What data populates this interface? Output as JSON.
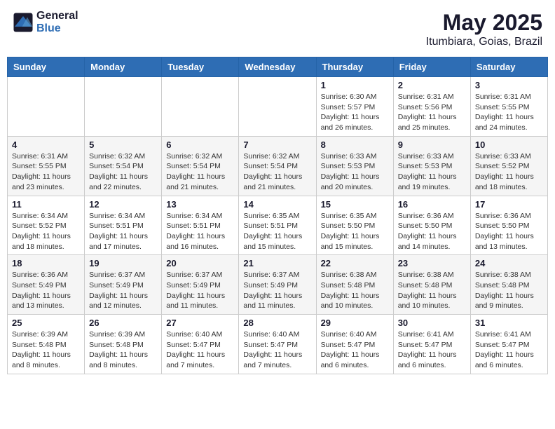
{
  "header": {
    "logo_general": "General",
    "logo_blue": "Blue",
    "month": "May 2025",
    "location": "Itumbiara, Goias, Brazil"
  },
  "days_of_week": [
    "Sunday",
    "Monday",
    "Tuesday",
    "Wednesday",
    "Thursday",
    "Friday",
    "Saturday"
  ],
  "weeks": [
    [
      {
        "day": "",
        "info": ""
      },
      {
        "day": "",
        "info": ""
      },
      {
        "day": "",
        "info": ""
      },
      {
        "day": "",
        "info": ""
      },
      {
        "day": "1",
        "info": "Sunrise: 6:30 AM\nSunset: 5:57 PM\nDaylight: 11 hours and 26 minutes."
      },
      {
        "day": "2",
        "info": "Sunrise: 6:31 AM\nSunset: 5:56 PM\nDaylight: 11 hours and 25 minutes."
      },
      {
        "day": "3",
        "info": "Sunrise: 6:31 AM\nSunset: 5:55 PM\nDaylight: 11 hours and 24 minutes."
      }
    ],
    [
      {
        "day": "4",
        "info": "Sunrise: 6:31 AM\nSunset: 5:55 PM\nDaylight: 11 hours and 23 minutes."
      },
      {
        "day": "5",
        "info": "Sunrise: 6:32 AM\nSunset: 5:54 PM\nDaylight: 11 hours and 22 minutes."
      },
      {
        "day": "6",
        "info": "Sunrise: 6:32 AM\nSunset: 5:54 PM\nDaylight: 11 hours and 21 minutes."
      },
      {
        "day": "7",
        "info": "Sunrise: 6:32 AM\nSunset: 5:54 PM\nDaylight: 11 hours and 21 minutes."
      },
      {
        "day": "8",
        "info": "Sunrise: 6:33 AM\nSunset: 5:53 PM\nDaylight: 11 hours and 20 minutes."
      },
      {
        "day": "9",
        "info": "Sunrise: 6:33 AM\nSunset: 5:53 PM\nDaylight: 11 hours and 19 minutes."
      },
      {
        "day": "10",
        "info": "Sunrise: 6:33 AM\nSunset: 5:52 PM\nDaylight: 11 hours and 18 minutes."
      }
    ],
    [
      {
        "day": "11",
        "info": "Sunrise: 6:34 AM\nSunset: 5:52 PM\nDaylight: 11 hours and 18 minutes."
      },
      {
        "day": "12",
        "info": "Sunrise: 6:34 AM\nSunset: 5:51 PM\nDaylight: 11 hours and 17 minutes."
      },
      {
        "day": "13",
        "info": "Sunrise: 6:34 AM\nSunset: 5:51 PM\nDaylight: 11 hours and 16 minutes."
      },
      {
        "day": "14",
        "info": "Sunrise: 6:35 AM\nSunset: 5:51 PM\nDaylight: 11 hours and 15 minutes."
      },
      {
        "day": "15",
        "info": "Sunrise: 6:35 AM\nSunset: 5:50 PM\nDaylight: 11 hours and 15 minutes."
      },
      {
        "day": "16",
        "info": "Sunrise: 6:36 AM\nSunset: 5:50 PM\nDaylight: 11 hours and 14 minutes."
      },
      {
        "day": "17",
        "info": "Sunrise: 6:36 AM\nSunset: 5:50 PM\nDaylight: 11 hours and 13 minutes."
      }
    ],
    [
      {
        "day": "18",
        "info": "Sunrise: 6:36 AM\nSunset: 5:49 PM\nDaylight: 11 hours and 13 minutes."
      },
      {
        "day": "19",
        "info": "Sunrise: 6:37 AM\nSunset: 5:49 PM\nDaylight: 11 hours and 12 minutes."
      },
      {
        "day": "20",
        "info": "Sunrise: 6:37 AM\nSunset: 5:49 PM\nDaylight: 11 hours and 11 minutes."
      },
      {
        "day": "21",
        "info": "Sunrise: 6:37 AM\nSunset: 5:49 PM\nDaylight: 11 hours and 11 minutes."
      },
      {
        "day": "22",
        "info": "Sunrise: 6:38 AM\nSunset: 5:48 PM\nDaylight: 11 hours and 10 minutes."
      },
      {
        "day": "23",
        "info": "Sunrise: 6:38 AM\nSunset: 5:48 PM\nDaylight: 11 hours and 10 minutes."
      },
      {
        "day": "24",
        "info": "Sunrise: 6:38 AM\nSunset: 5:48 PM\nDaylight: 11 hours and 9 minutes."
      }
    ],
    [
      {
        "day": "25",
        "info": "Sunrise: 6:39 AM\nSunset: 5:48 PM\nDaylight: 11 hours and 8 minutes."
      },
      {
        "day": "26",
        "info": "Sunrise: 6:39 AM\nSunset: 5:48 PM\nDaylight: 11 hours and 8 minutes."
      },
      {
        "day": "27",
        "info": "Sunrise: 6:40 AM\nSunset: 5:47 PM\nDaylight: 11 hours and 7 minutes."
      },
      {
        "day": "28",
        "info": "Sunrise: 6:40 AM\nSunset: 5:47 PM\nDaylight: 11 hours and 7 minutes."
      },
      {
        "day": "29",
        "info": "Sunrise: 6:40 AM\nSunset: 5:47 PM\nDaylight: 11 hours and 6 minutes."
      },
      {
        "day": "30",
        "info": "Sunrise: 6:41 AM\nSunset: 5:47 PM\nDaylight: 11 hours and 6 minutes."
      },
      {
        "day": "31",
        "info": "Sunrise: 6:41 AM\nSunset: 5:47 PM\nDaylight: 11 hours and 6 minutes."
      }
    ]
  ]
}
